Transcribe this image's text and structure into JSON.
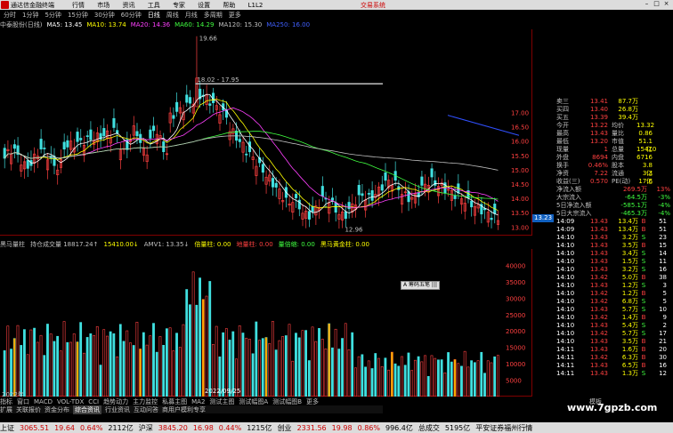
{
  "app": {
    "title": "通达信金融终端",
    "menu": [
      "行情",
      "市场",
      "资讯",
      "工具",
      "专家",
      "设置",
      "帮助",
      "L1L2"
    ],
    "right_link": "交易系统"
  },
  "periods": {
    "items": [
      "分时",
      "1分钟",
      "5分钟",
      "15分钟",
      "30分钟",
      "60分钟",
      "日线",
      "周线",
      "月线",
      "多周期",
      "更多"
    ],
    "selected": "日线"
  },
  "indicator_line": {
    "stock": "中泰股份(日线)",
    "items": [
      {
        "label": "MA5: 13.45",
        "color": "#ffffff"
      },
      {
        "label": "MA10: 13.74",
        "color": "#ffff00"
      },
      {
        "label": "MA20: 14.36",
        "color": "#ff40ff"
      },
      {
        "label": "MA60: 14.29",
        "color": "#40ff40"
      },
      {
        "label": "MA120: 15.30",
        "color": "#c0c0c0"
      },
      {
        "label": "MA250: 16.00",
        "color": "#4060ff"
      }
    ]
  },
  "kchart": {
    "annotations": {
      "high": "19.66",
      "box": "18.02 - 17.95",
      "low": "12.96",
      "current": "13.23"
    },
    "price_axis": [
      "17.00",
      "16.50",
      "16.00",
      "15.50",
      "15.00",
      "14.50",
      "14.00",
      "13.50",
      "13.00"
    ]
  },
  "volume_line": {
    "items": [
      {
        "label": "黑马量柱",
        "color": "#c0c0c0"
      },
      {
        "label": "持仓成交量 18817.24↑",
        "color": "#c0c0c0"
      },
      {
        "label": "15410.00↓",
        "color": "#ffff00"
      },
      {
        "label": "AMV1: 13.35↓",
        "color": "#c0c0c0"
      },
      {
        "label": "倍量柱: 0.00",
        "color": "#ffff00"
      },
      {
        "label": "地量柱: 0.00",
        "color": "#ff4040"
      },
      {
        "label": "量倍缩: 0.00",
        "color": "#40ff40"
      },
      {
        "label": "黑马黄金柱: 0.00",
        "color": "#ffff00"
      }
    ],
    "axis": [
      "40000",
      "35000",
      "30000",
      "25000",
      "20000",
      "15000",
      "10000",
      "5000"
    ],
    "date_marker": "2022/09/25",
    "year_label": "2022年",
    "month_label": "12"
  },
  "quote": {
    "asks": [
      {
        "label": "卖三",
        "price": "13.41",
        "vol": "87.7万"
      },
      {
        "label": "买四",
        "price": "13.40",
        "vol": "26.8万"
      },
      {
        "label": "买五",
        "price": "13.39",
        "vol": "39.4万"
      }
    ],
    "stats": [
      {
        "label": "今开",
        "v": "13.22",
        "label2": "均价",
        "v2": "13.32"
      },
      {
        "label": "最高",
        "v": "13.43",
        "label2": "量比",
        "v2": "0.86"
      },
      {
        "label": "最低",
        "v": "13.20",
        "label2": "市值",
        "v2": "51.1亿"
      },
      {
        "label": "现量",
        "v": "1",
        "label2": "总量",
        "v2": "15410"
      },
      {
        "label": "外盘",
        "v": "8694",
        "label2": "内盘",
        "v2": "6716"
      },
      {
        "label": "换手",
        "v": "0.46%",
        "label2": "股本",
        "v2": "3.8亿"
      },
      {
        "label": "净资",
        "v": "7.22",
        "label2": "流通",
        "v2": "3.3亿"
      },
      {
        "label": "收益(三)",
        "v": "0.570",
        "label2": "PE(动)",
        "v2": "17.6"
      }
    ],
    "flows": [
      {
        "label": "净流入额",
        "val": "269.5万",
        "pct": "13%"
      },
      {
        "label": "大宗流入",
        "val": "-64.5万",
        "pct": "-3%"
      },
      {
        "label": "5日净流入额",
        "val": "-585.1万",
        "pct": "-4%"
      },
      {
        "label": "5日大宗流入",
        "val": "-465.3万",
        "pct": "-4%"
      }
    ],
    "ticks": [
      {
        "t": "14:09",
        "p": "13.43",
        "v": "13.4万",
        "bs": "B",
        "n": "51"
      },
      {
        "t": "14:09",
        "p": "13.43",
        "v": "13.4万",
        "bs": "B",
        "n": "51"
      },
      {
        "t": "14:10",
        "p": "13.43",
        "v": "3.2万",
        "bs": "S",
        "n": "23"
      },
      {
        "t": "14:10",
        "p": "13.43",
        "v": "3.5万",
        "bs": "B",
        "n": "15"
      },
      {
        "t": "14:10",
        "p": "13.43",
        "v": "3.4万",
        "bs": "S",
        "n": "14"
      },
      {
        "t": "14:10",
        "p": "13.43",
        "v": "1.5万",
        "bs": "S",
        "n": "11"
      },
      {
        "t": "14:10",
        "p": "13.43",
        "v": "3.2万",
        "bs": "S",
        "n": "16"
      },
      {
        "t": "14:10",
        "p": "13.42",
        "v": "5.0万",
        "bs": "B",
        "n": "38"
      },
      {
        "t": "14:10",
        "p": "13.43",
        "v": "1.2万",
        "bs": "S",
        "n": "3"
      },
      {
        "t": "14:10",
        "p": "13.42",
        "v": "1.2万",
        "bs": "B",
        "n": "5"
      },
      {
        "t": "14:10",
        "p": "13.42",
        "v": "6.8万",
        "bs": "S",
        "n": "5"
      },
      {
        "t": "14:10",
        "p": "13.43",
        "v": "5.7万",
        "bs": "S",
        "n": "10"
      },
      {
        "t": "14:10",
        "p": "13.42",
        "v": "1.4万",
        "bs": "B",
        "n": "9"
      },
      {
        "t": "14:10",
        "p": "13.43",
        "v": "5.4万",
        "bs": "S",
        "n": "2"
      },
      {
        "t": "14:10",
        "p": "13.42",
        "v": "5.7万",
        "bs": "S",
        "n": "17"
      },
      {
        "t": "14:10",
        "p": "13.43",
        "v": "3.5万",
        "bs": "B",
        "n": "21"
      },
      {
        "t": "14:11",
        "p": "13.43",
        "v": "1.6万",
        "bs": "B",
        "n": "20"
      },
      {
        "t": "14:11",
        "p": "13.42",
        "v": "6.3万",
        "bs": "B",
        "n": "30"
      },
      {
        "t": "14:11",
        "p": "13.43",
        "v": "6.5万",
        "bs": "B",
        "n": "16"
      },
      {
        "t": "14:11",
        "p": "13.43",
        "v": "1.3万",
        "bs": "S",
        "n": "12"
      }
    ]
  },
  "popup": "A 筹码五笔 ||| ",
  "tabs1": [
    "指标",
    "窗口",
    "MACD",
    "VOL-TDX",
    "CCI",
    "趋势动力",
    "主力监控",
    "私募主图",
    "MA2",
    "测试主图",
    "测试幅图A",
    "测试幅图B",
    "更多"
  ],
  "tabs1_right": "模板",
  "tabs2": [
    "扩展",
    "关联报价",
    "资金分布",
    "综合资讯",
    "行业资讯",
    "互动问答",
    "商用户模利专享"
  ],
  "tabs2_selected": "综合资讯",
  "status": [
    {
      "name": "上证",
      "v": "3065.51",
      "c": "19.64",
      "p": "0.64%",
      "a": "2112亿"
    },
    {
      "name": "沪深",
      "v": "3845.20",
      "c": "16.98",
      "p": "0.44%",
      "a": "1215亿"
    },
    {
      "name": "创业",
      "v": "2331.56",
      "c": "19.98",
      "p": "0.86%",
      "a": "996.4亿"
    }
  ],
  "status_right": [
    "总成交",
    "5195亿",
    "平安证券福州行情"
  ],
  "watermark": "www.7gpzb.com",
  "tabs1_right_text": "图文F10 聊"
}
